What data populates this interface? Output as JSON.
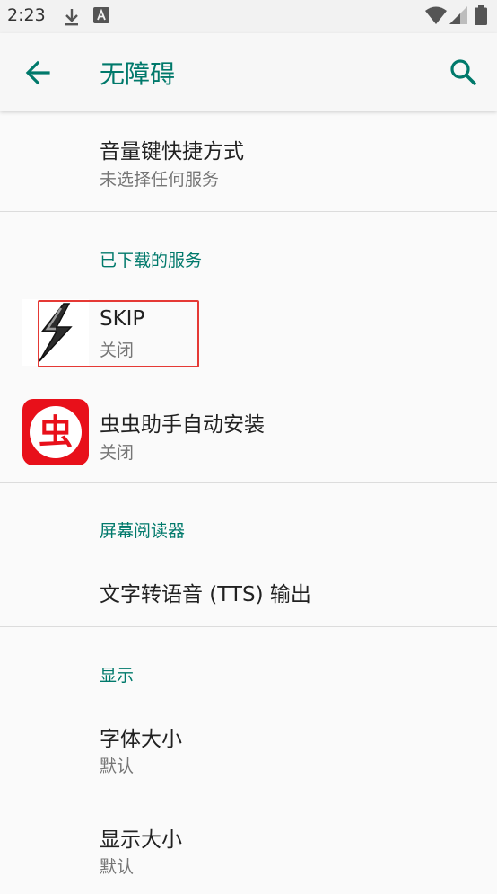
{
  "status_bar": {
    "time": "2:23",
    "icons": [
      "download-icon",
      "keyboard-a-icon",
      "wifi-icon",
      "signal-icon",
      "battery-icon"
    ]
  },
  "app_bar": {
    "title": "无障碍",
    "back_icon": "back-arrow-icon",
    "search_icon": "search-icon",
    "accent": "#00796b"
  },
  "volume_shortcut": {
    "title": "音量键快捷方式",
    "summary": "未选择任何服务"
  },
  "downloaded_services": {
    "header": "已下载的服务",
    "items": [
      {
        "title": "SKIP",
        "summary": "关闭",
        "icon": "skip-lightning-icon"
      },
      {
        "title": "虫虫助手自动安装",
        "summary": "关闭",
        "icon": "chongchong-icon",
        "icon_glyph": "虫"
      }
    ]
  },
  "screen_reader": {
    "header": "屏幕阅读器",
    "items": [
      {
        "title": "文字转语音 (TTS) 输出"
      }
    ]
  },
  "display": {
    "header": "显示",
    "items": [
      {
        "title": "字体大小",
        "summary": "默认"
      },
      {
        "title": "显示大小",
        "summary": "默认"
      }
    ]
  },
  "colors": {
    "highlight_box": "#e53935",
    "chongchong_red": "#e8101a"
  }
}
